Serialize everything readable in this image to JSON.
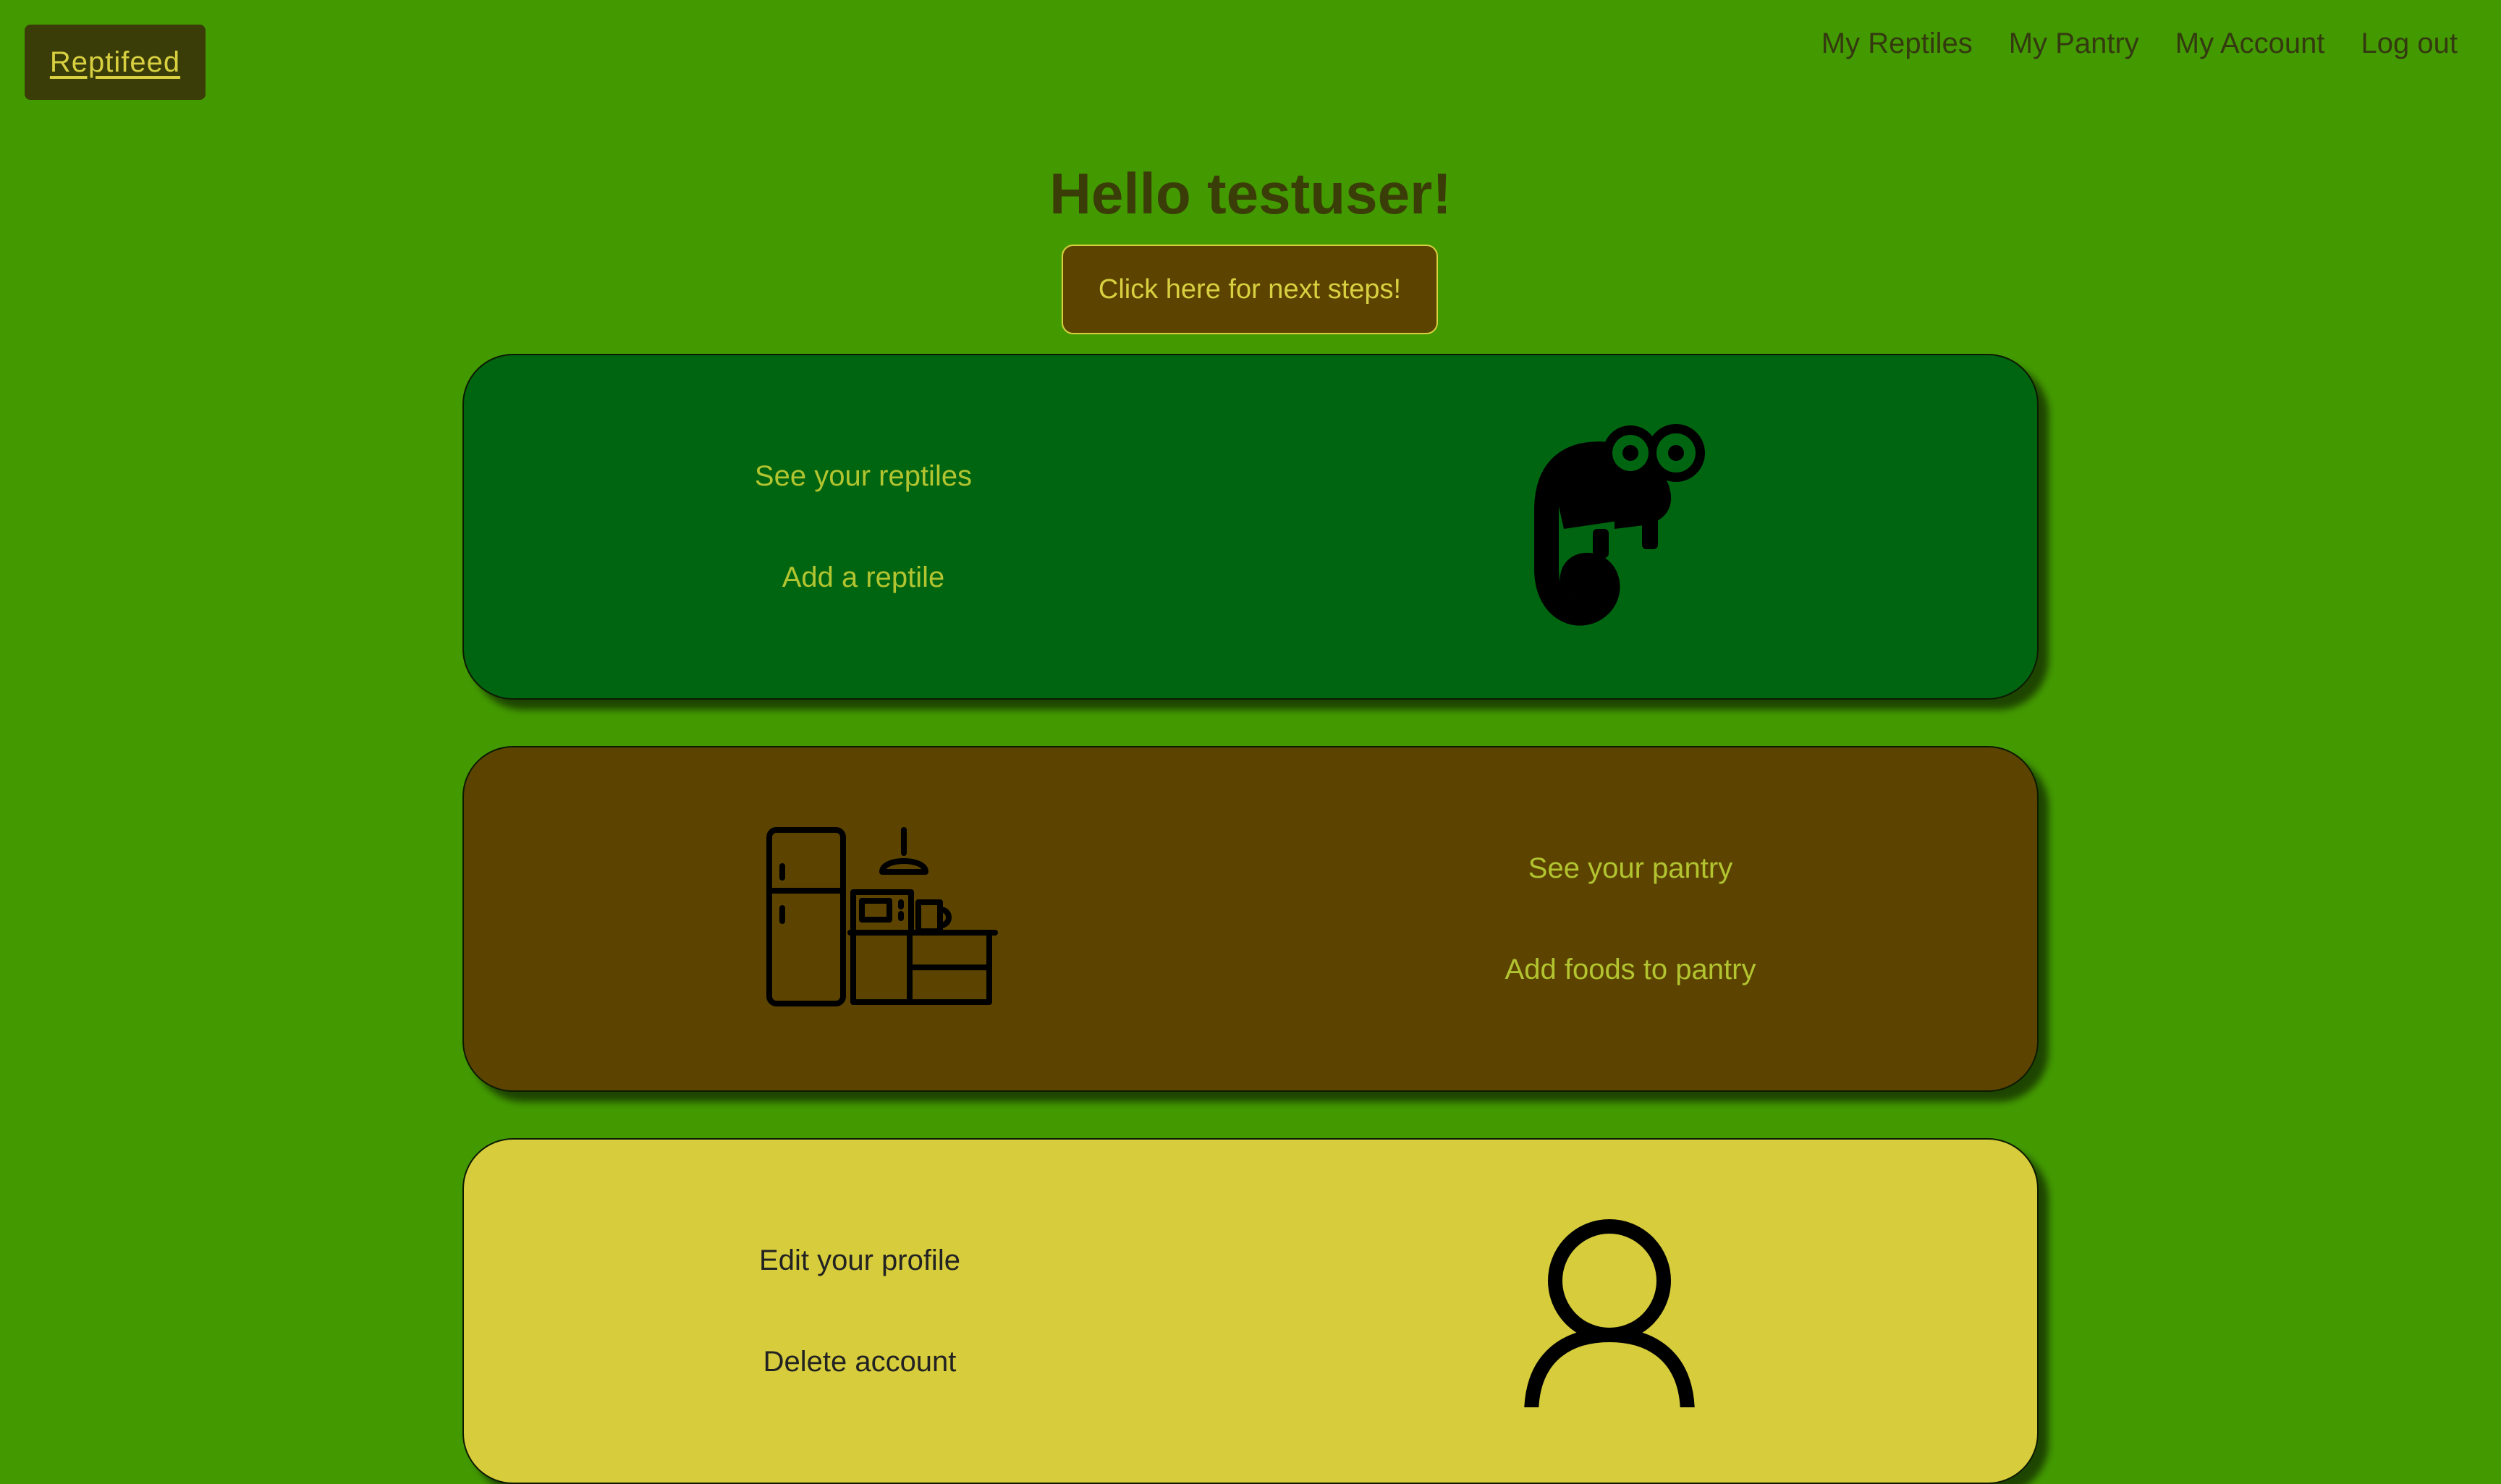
{
  "brand": {
    "label": "Reptifeed"
  },
  "nav": {
    "items": [
      {
        "label": "My Reptiles"
      },
      {
        "label": "My Pantry"
      },
      {
        "label": "My Account"
      },
      {
        "label": "Log out"
      }
    ]
  },
  "greeting": "Hello testuser!",
  "next_steps_button": "Click here for next steps!",
  "cards": {
    "reptiles": {
      "links": [
        "See your reptiles",
        "Add a reptile"
      ],
      "icon": "chameleon-icon",
      "background": "#006510"
    },
    "pantry": {
      "links": [
        "See your pantry",
        "Add foods to pantry"
      ],
      "icon": "kitchen-icon",
      "background": "#5c4400"
    },
    "account": {
      "links": [
        "Edit your profile",
        "Delete account"
      ],
      "icon": "user-icon",
      "background": "#d6cc3c"
    }
  },
  "colors": {
    "page_background": "#439a00",
    "brand_background": "#3a3d08",
    "accent_text": "#d8d040",
    "link_text": "#b2c430"
  }
}
